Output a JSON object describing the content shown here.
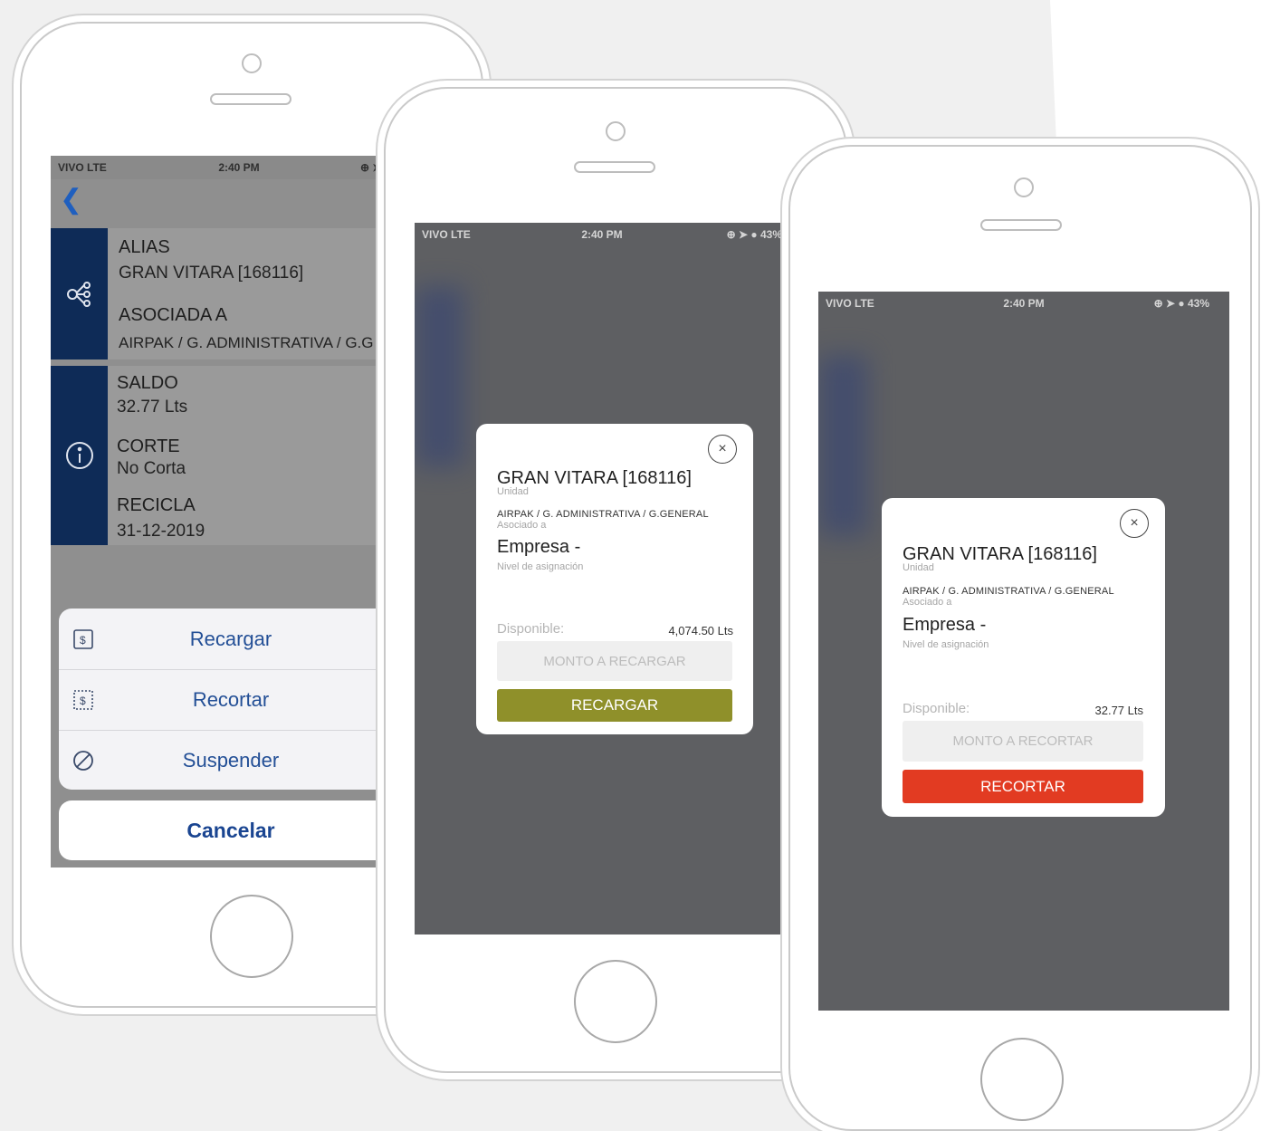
{
  "phone1": {
    "status": {
      "carrier": "VIVO  LTE",
      "time": "2:40 PM",
      "icons": "⊕ ➤ ●"
    },
    "back_icon": "chevron-left-icon",
    "alias_label": "ALIAS",
    "alias_value": "GRAN VITARA [168116]",
    "asociada_label": "ASOCIADA A",
    "asociada_value": "AIRPAK / G. ADMINISTRATIVA / G.G",
    "saldo_label": "SALDO",
    "saldo_value": "32.77 Lts",
    "corte_label": "CORTE",
    "corte_value": "No Corta",
    "recicla_label": "RECICLA",
    "recicla_value": "31-12-2019",
    "actions": [
      {
        "label": "Recargar",
        "icon": "recharge-icon"
      },
      {
        "label": "Recortar",
        "icon": "cut-money-icon"
      },
      {
        "label": "Suspender",
        "icon": "suspend-icon"
      }
    ],
    "cancel_label": "Cancelar"
  },
  "phone2": {
    "status": {
      "carrier": "VIVO  LTE",
      "time": "2:40 PM",
      "icons": "⊕ ➤ ● 43%"
    },
    "title": "GRAN VITARA [168116]",
    "title_caption": "Unidad",
    "assoc": "AIRPAK / G. ADMINISTRATIVA / G.GENERAL",
    "assoc_caption": "Asociado a",
    "empresa": "Empresa -",
    "empresa_caption": "Nivel de asignación",
    "disponible_label": "Disponible:",
    "disponible_value": "4,074.50 Lts",
    "input_placeholder": "MONTO A RECARGAR",
    "button_label": "RECARGAR",
    "button_color": "#8f902a",
    "close_icon": "×"
  },
  "phone3": {
    "status": {
      "carrier": "VIVO  LTE",
      "time": "2:40 PM",
      "icons": "⊕ ➤ ● 43%"
    },
    "title": "GRAN VITARA [168116]",
    "title_caption": "Unidad",
    "assoc": "AIRPAK / G. ADMINISTRATIVA / G.GENERAL",
    "assoc_caption": "Asociado a",
    "empresa": "Empresa -",
    "empresa_caption": "Nivel de asignación",
    "disponible_label": "Disponible:",
    "disponible_value": "32.77 Lts",
    "input_placeholder": "MONTO A RECORTAR",
    "button_label": "RECORTAR",
    "button_color": "#e23b22",
    "close_icon": "×"
  }
}
